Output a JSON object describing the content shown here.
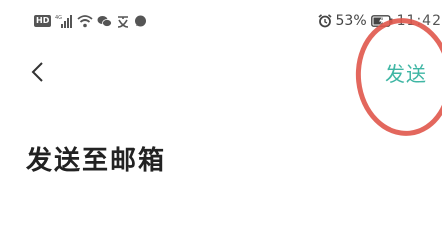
{
  "status_bar": {
    "hd_label": "HD",
    "network_label": "4G",
    "battery_percent": "53%",
    "time": "11:42"
  },
  "nav": {
    "send_label": "发送",
    "back_icon": "chevron-left-icon"
  },
  "main": {
    "title": "发送至邮箱"
  },
  "colors": {
    "accent": "#3fb6a4",
    "annotation": "#e0574b",
    "title_text": "#222222"
  }
}
